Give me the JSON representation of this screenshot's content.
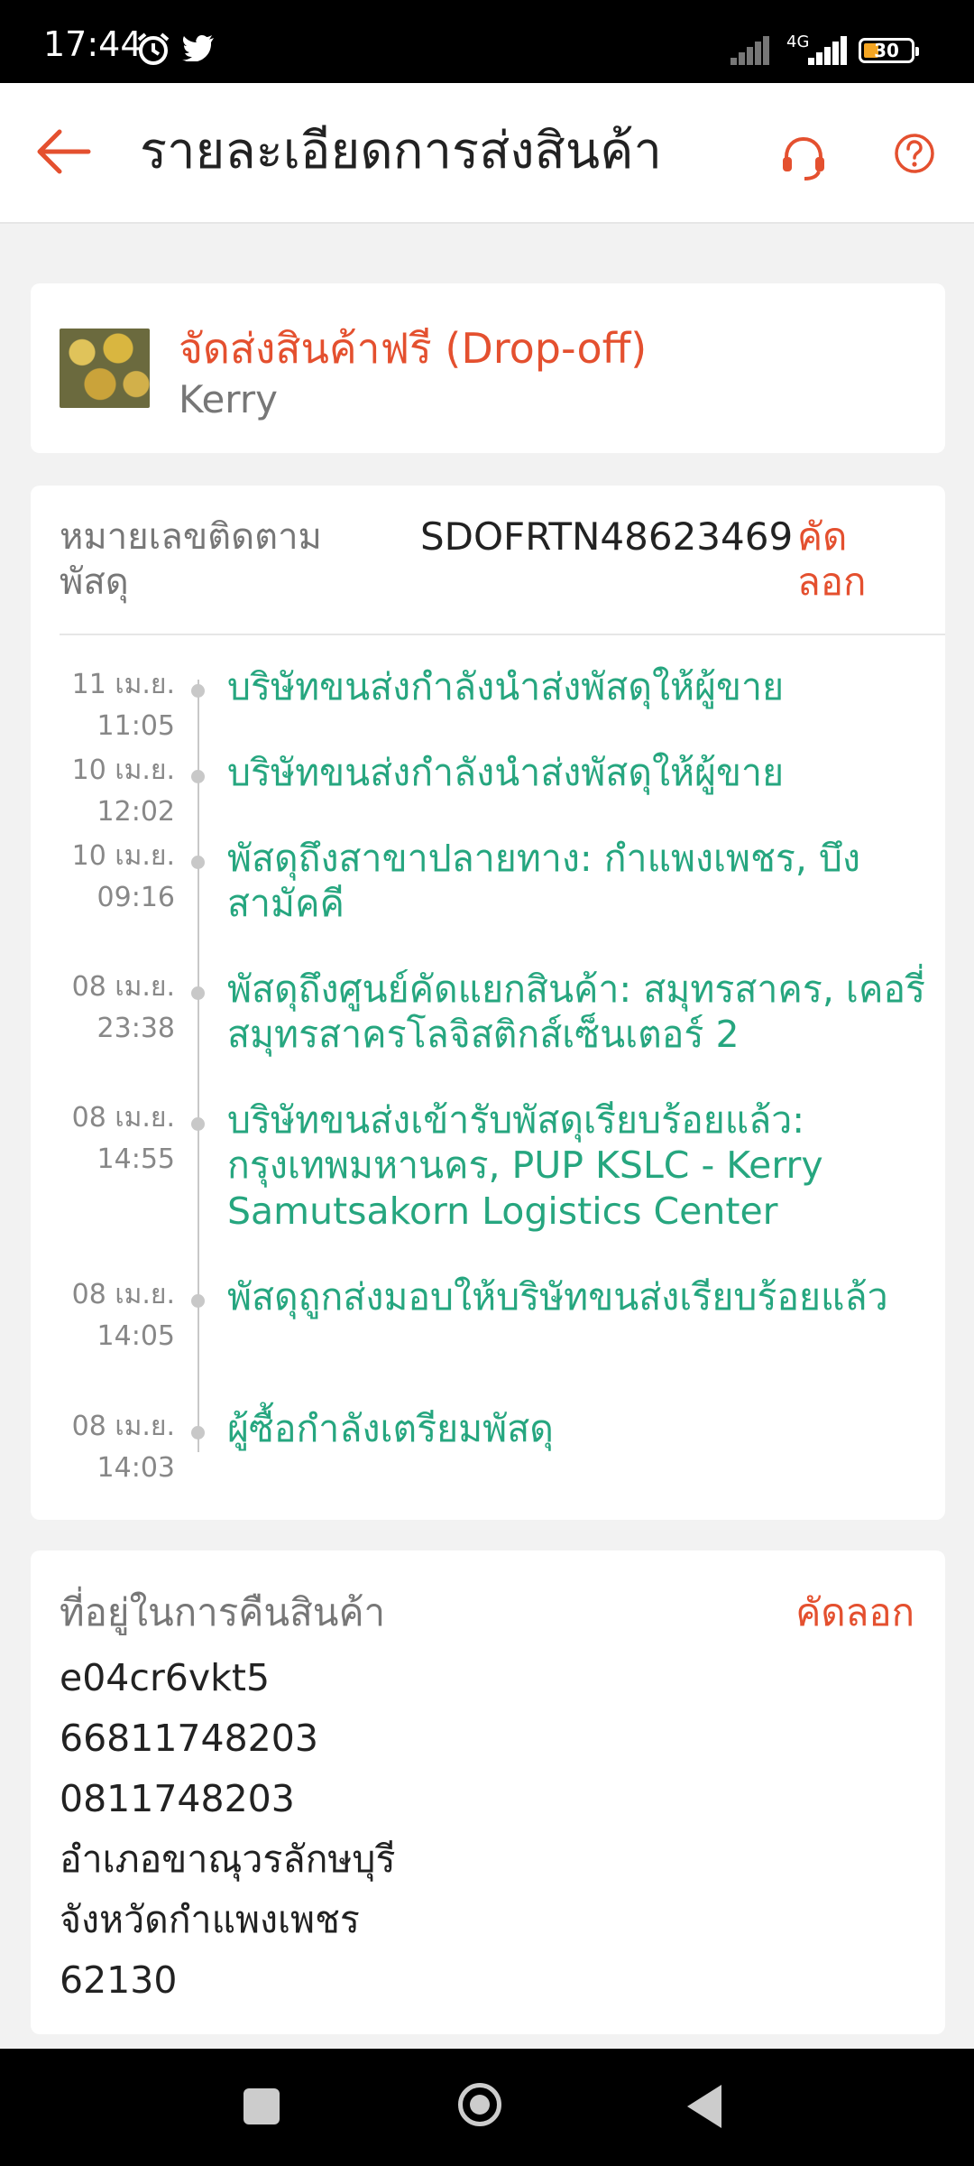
{
  "status_bar": {
    "time": "17:44",
    "network": "4G",
    "battery": "30",
    "icons": [
      "alarm-icon",
      "twitter-icon",
      "signal-icon",
      "battery-icon"
    ]
  },
  "app_bar": {
    "title": "รายละเอียดการส่งสินค้า",
    "back_icon": "arrow-left-icon",
    "support_icon": "headset-icon",
    "help_icon": "question-icon",
    "accent": "#e4502f"
  },
  "shipping": {
    "method": "จัดส่งสินค้าฟรี (Drop-off)",
    "carrier": "Kerry"
  },
  "tracking": {
    "label": "หมายเลขติดตามพัสดุ",
    "number": "SDOFRTN48623469",
    "copy_label": "คัดลอก",
    "events": [
      {
        "date": "11 เม.ย.",
        "time": "11:05",
        "text": "บริษัทขนส่งกำลังนำส่งพัสดุให้ผู้ขาย"
      },
      {
        "date": "10 เม.ย.",
        "time": "12:02",
        "text": "บริษัทขนส่งกำลังนำส่งพัสดุให้ผู้ขาย"
      },
      {
        "date": "10 เม.ย.",
        "time": "09:16",
        "text": "พัสดุถึงสาขาปลายทาง: กำแพงเพชร, บึงสามัคคี"
      },
      {
        "date": "08 เม.ย.",
        "time": "23:38",
        "text": "พัสดุถึงศูนย์คัดแยกสินค้า: สมุทรสาคร, เคอรี่สมุทรสาครโลจิสติกส์เซ็นเตอร์ 2"
      },
      {
        "date": "08 เม.ย.",
        "time": "14:55",
        "text": "บริษัทขนส่งเข้ารับพัสดุเรียบร้อยแล้ว: กรุงเทพมหานคร, PUP KSLC - Kerry Samutsakorn Logistics Center"
      },
      {
        "date": "08 เม.ย.",
        "time": "14:05",
        "text": "พัสดุถูกส่งมอบให้บริษัทขนส่งเรียบร้อยแล้ว"
      },
      {
        "date": "08 เม.ย.",
        "time": "14:03",
        "text": "ผู้ซื้อกำลังเตรียมพัสดุ"
      }
    ]
  },
  "return_address": {
    "label": "ที่อยู่ในการคืนสินค้า",
    "copy_label": "คัดลอก",
    "lines": [
      "e04cr6vkt5",
      "66811748203",
      "0811748203",
      "อำเภอขาณุวรลักษบุรี",
      "จังหวัดกำแพงเพชร",
      "62130"
    ]
  }
}
